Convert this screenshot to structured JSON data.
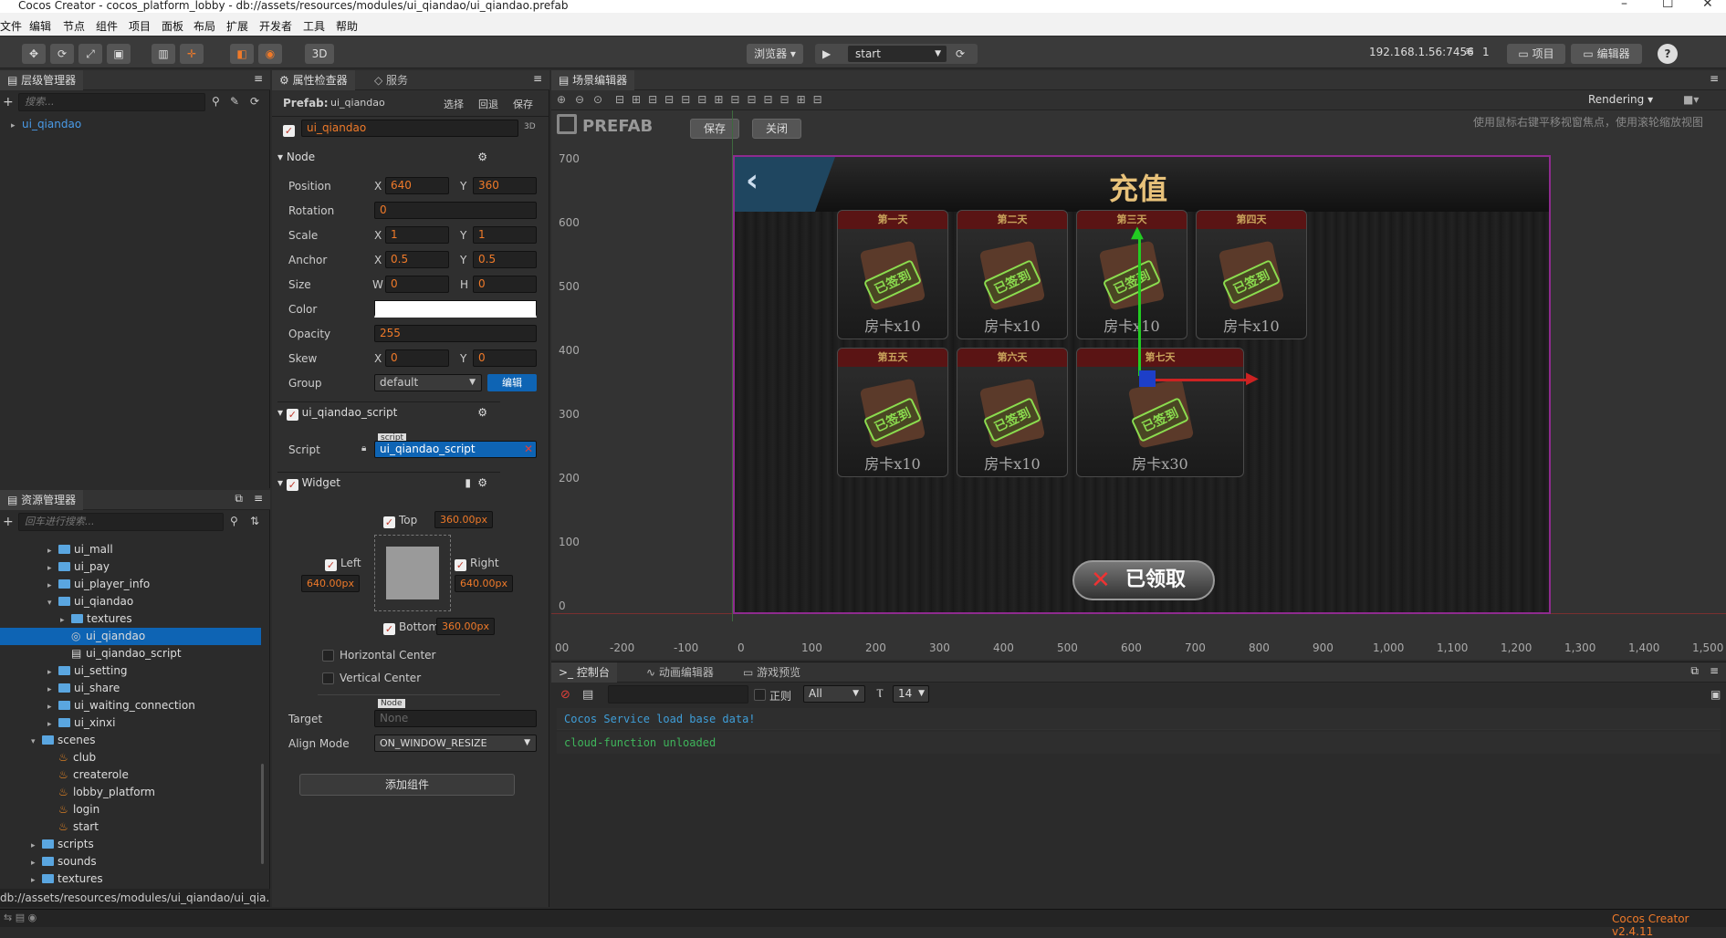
{
  "window": {
    "title": "Cocos Creator - cocos_platform_lobby - db://assets/resources/modules/ui_qiandao/ui_qiandao.prefab"
  },
  "menu": [
    "文件",
    "编辑",
    "节点",
    "组件",
    "项目",
    "面板",
    "布局",
    "扩展",
    "开发者",
    "工具",
    "帮助"
  ],
  "toolbar": {
    "mode3d": "3D",
    "browser": "浏览器 ▾",
    "scene": "start",
    "ip": "192.168.1.56:7456",
    "clients": "1",
    "project": "项目",
    "editor": "编辑器",
    "help": "?"
  },
  "hierarchy": {
    "title": "层级管理器",
    "search_placeholder": "搜索...",
    "root": "ui_qiandao"
  },
  "inspector": {
    "tab1": "属性检查器",
    "tab2": "服务",
    "prefab_label": "Prefab:",
    "prefab_name": "ui_qiandao",
    "btn_select": "选择",
    "btn_revert": "回退",
    "btn_save": "保存",
    "node_name": "ui_qiandao",
    "badge3d": "3D",
    "node_section": "Node",
    "position_label": "Position",
    "pos_x": "640",
    "pos_y": "360",
    "rotation_label": "Rotation",
    "rotation": "0",
    "scale_label": "Scale",
    "scale_x": "1",
    "scale_y": "1",
    "anchor_label": "Anchor",
    "anchor_x": "0.5",
    "anchor_y": "0.5",
    "size_label": "Size",
    "size_w": "0",
    "size_h": "0",
    "color_label": "Color",
    "opacity_label": "Opacity",
    "opacity": "255",
    "skew_label": "Skew",
    "skew_x": "0",
    "skew_y": "0",
    "group_label": "Group",
    "group": "default",
    "group_edit": "编辑",
    "x": "X",
    "y": "Y",
    "w": "W",
    "h": "H",
    "script_section": "ui_qiandao_script",
    "script_label": "Script",
    "script_tag": "script",
    "script_value": "ui_qiandao_script",
    "widget_section": "Widget",
    "top": "Top",
    "top_val": "360.00px",
    "left": "Left",
    "left_val": "640.00px",
    "right": "Right",
    "right_val": "640.00px",
    "bottom": "Bottom",
    "bottom_val": "360.00px",
    "hcenter": "Horizontal Center",
    "vcenter": "Vertical Center",
    "target_label": "Target",
    "target_tag": "Node",
    "target_val": "None",
    "align_label": "Align Mode",
    "align_val": "ON_WINDOW_RESIZE",
    "add_component": "添加组件"
  },
  "assets": {
    "title": "资源管理器",
    "search_placeholder": "回车进行搜索...",
    "items": [
      {
        "name": "ui_mall",
        "indent": 0,
        "type": "folder",
        "arrow": "▸"
      },
      {
        "name": "ui_pay",
        "indent": 0,
        "type": "folder",
        "arrow": "▸"
      },
      {
        "name": "ui_player_info",
        "indent": 0,
        "type": "folder",
        "arrow": "▸"
      },
      {
        "name": "ui_qiandao",
        "indent": 0,
        "type": "folder",
        "arrow": "▾"
      },
      {
        "name": "textures",
        "indent": 1,
        "type": "folder",
        "arrow": "▸"
      },
      {
        "name": "ui_qiandao",
        "indent": 1,
        "type": "prefab",
        "arrow": ""
      },
      {
        "name": "ui_qiandao_script",
        "indent": 1,
        "type": "script",
        "arrow": ""
      },
      {
        "name": "ui_setting",
        "indent": 0,
        "type": "folder",
        "arrow": "▸"
      },
      {
        "name": "ui_share",
        "indent": 0,
        "type": "folder",
        "arrow": "▸"
      },
      {
        "name": "ui_waiting_connection",
        "indent": 0,
        "type": "folder",
        "arrow": "▸"
      },
      {
        "name": "ui_xinxi",
        "indent": 0,
        "type": "folder",
        "arrow": "▸"
      },
      {
        "name": "scenes",
        "indent": -1,
        "type": "folder",
        "arrow": "▾"
      },
      {
        "name": "club",
        "indent": 0,
        "type": "scene",
        "arrow": ""
      },
      {
        "name": "createrole",
        "indent": 0,
        "type": "scene",
        "arrow": ""
      },
      {
        "name": "lobby_platform",
        "indent": 0,
        "type": "scene",
        "arrow": ""
      },
      {
        "name": "login",
        "indent": 0,
        "type": "scene",
        "arrow": ""
      },
      {
        "name": "start",
        "indent": 0,
        "type": "scene",
        "arrow": ""
      },
      {
        "name": "scripts",
        "indent": -1,
        "type": "folder",
        "arrow": "▸"
      },
      {
        "name": "sounds",
        "indent": -1,
        "type": "folder",
        "arrow": "▸"
      },
      {
        "name": "textures",
        "indent": -1,
        "type": "folder",
        "arrow": "▸"
      }
    ],
    "path": "db://assets/resources/modules/ui_qiandao/ui_qia..."
  },
  "scene": {
    "title": "场景编辑器",
    "prefab_logo": "PREFAB",
    "btn_save": "保存",
    "btn_close": "关闭",
    "rendering": "Rendering",
    "hint": "使用鼠标右键平移视窗焦点，使用滚轮缩放视图",
    "yticks": [
      "700",
      "600",
      "500",
      "400",
      "300",
      "200",
      "100",
      "0"
    ],
    "xticks": [
      "00",
      "-200",
      "-100",
      "0",
      "100",
      "200",
      "300",
      "400",
      "500",
      "600",
      "700",
      "800",
      "900",
      "1,000",
      "1,100",
      "1,200",
      "1,300",
      "1,400",
      "1,500"
    ],
    "game_title": "充值",
    "claim_btn": "已领取",
    "cards": [
      {
        "day": "第一天",
        "reward": "房卡x10"
      },
      {
        "day": "第二天",
        "reward": "房卡x10"
      },
      {
        "day": "第三天",
        "reward": "房卡x10"
      },
      {
        "day": "第四天",
        "reward": "房卡x10"
      },
      {
        "day": "第五天",
        "reward": "房卡x10"
      },
      {
        "day": "第六天",
        "reward": "房卡x10"
      },
      {
        "day": "第七天",
        "reward": "房卡x30"
      }
    ],
    "stamp": "已签到"
  },
  "console": {
    "tab1": "控制台",
    "tab2": "动画编辑器",
    "tab3": "游戏预览",
    "regex": "正则",
    "level": "All",
    "fontsize": "14",
    "lines": [
      "Cocos Service load base data!",
      "cloud-function unloaded"
    ]
  },
  "status": {
    "version": "Cocos Creator v2.4.11"
  },
  "colors": {
    "accent": "#f07a29",
    "selection": "#0e64b4",
    "console_blue": "#3f9ed8",
    "console_green": "#3fb55b",
    "prefab_border": "#8e2b8e"
  }
}
